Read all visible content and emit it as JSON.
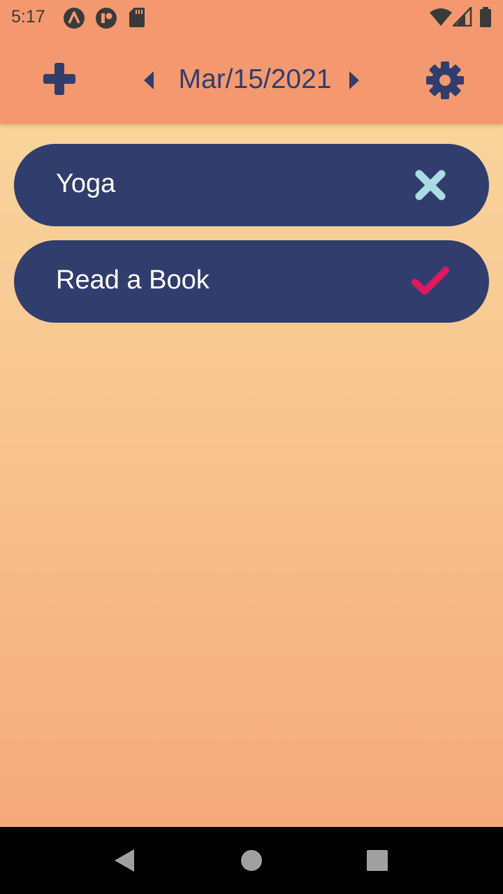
{
  "status_bar": {
    "time": "5:17",
    "left_icons": [
      "a-circle-icon",
      "d-circle-icon",
      "sd-card-icon"
    ],
    "right_icons": [
      "wifi-icon",
      "signal-icon",
      "battery-icon"
    ]
  },
  "header": {
    "add_icon": "plus-icon",
    "prev_icon": "caret-left-icon",
    "date": "Mar/15/2021",
    "next_icon": "caret-right-icon",
    "settings_icon": "gear-icon"
  },
  "tasks": [
    {
      "label": "Yoga",
      "status": "not-done",
      "status_icon": "close-icon",
      "status_color": "#a9dde3"
    },
    {
      "label": "Read a Book",
      "status": "done",
      "status_icon": "check-icon",
      "status_color": "#e0185f"
    }
  ],
  "nav_bar": {
    "buttons": [
      "back-icon",
      "home-icon",
      "recents-icon"
    ]
  },
  "colors": {
    "accent": "#313d6d",
    "appbar": "#f4996f",
    "background_top": "#f9dba0",
    "background_bottom": "#f4a577"
  }
}
